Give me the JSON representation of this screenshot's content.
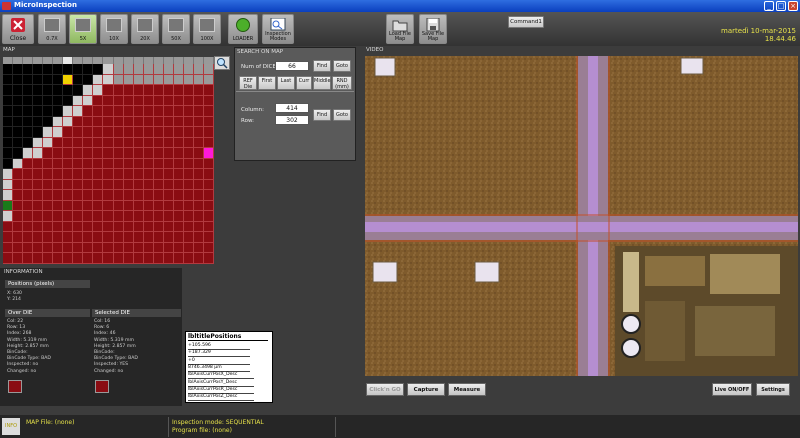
{
  "window": {
    "title": "MicroInspection"
  },
  "toolbar": {
    "close_label": "Close",
    "lens_buttons": [
      "0.7X",
      "5X",
      "10X",
      "20X",
      "50X",
      "100X"
    ],
    "selected_lens": "5X",
    "loader_label": "LOADER",
    "inspection_modes_label": "Inspection Modes",
    "load_file_map_label": "Load File Map",
    "save_file_map_label": "Save File Map",
    "command_label": "Command1",
    "date": "martedì 10-mar-2015",
    "time": "18.44.46"
  },
  "map": {
    "title": "MAP",
    "columns": 21,
    "rows": 19,
    "colors": {
      "bad": "#8a0c12",
      "good": "#1a7a1a",
      "empty": "#000000",
      "edge": "#cfcfcf",
      "selected": "#f1d100",
      "over": "#ff19d8"
    }
  },
  "search": {
    "title": "SEARCH ON MAP",
    "num_dice_label": "Num of DICE:",
    "num_dice_value": "66",
    "find_label": "Find",
    "goto_label": "Goto",
    "nav_buttons": [
      "REF Die",
      "First",
      "Last",
      "Curr",
      "Middle",
      "RND (mm)"
    ],
    "column_label": "Column:",
    "column_value": "414",
    "row_label": "Row:",
    "row_value": "302"
  },
  "info": {
    "title": "INFORMATION",
    "positions_title": "Positions (pixels)",
    "positions": [
      "X: 630",
      "Y: 214"
    ],
    "over_title": "Over DIE",
    "over_lines": [
      "Col: 22",
      "Row: 13",
      "Index: 268",
      "Width: 5.319 mm",
      "Height: 2.857 mm",
      "BinCode:",
      "BinCode Type: BAD",
      "Inspected: no",
      "Changed: no"
    ],
    "selected_title": "Selected DIE",
    "selected_lines": [
      "Col: 16",
      "Row: 6",
      "Index: 46",
      "Width: 5.319 mm",
      "Height: 2.857 mm",
      "BinCode:",
      "BinCode Type: BAD",
      "Inspected: YES",
      "Changed: no"
    ]
  },
  "bit_positions": {
    "title": "lbltitlePositions",
    "rows": [
      "+105.596",
      "+187.329",
      "+0",
      "8746.3498 µm",
      "lblAxisCurrPosX_Desc",
      "lblAxisCurrPosY_Desc",
      "lblAxisCurrPosR_Desc",
      "lblAxisCurrPosZ_Desc"
    ]
  },
  "video": {
    "title": "VIDEO",
    "clickgo_label": "Click'n GO",
    "capture_label": "Capture",
    "measure_label": "Measure",
    "live_label": "Live ON/OFF",
    "settings_label": "Settings"
  },
  "status": {
    "info_label": "INFO",
    "map_file": "MAP File:  (none)",
    "inspection_mode": "Inspection mode: SEQUENTIAL",
    "program_file": "Program file:  (none)"
  }
}
